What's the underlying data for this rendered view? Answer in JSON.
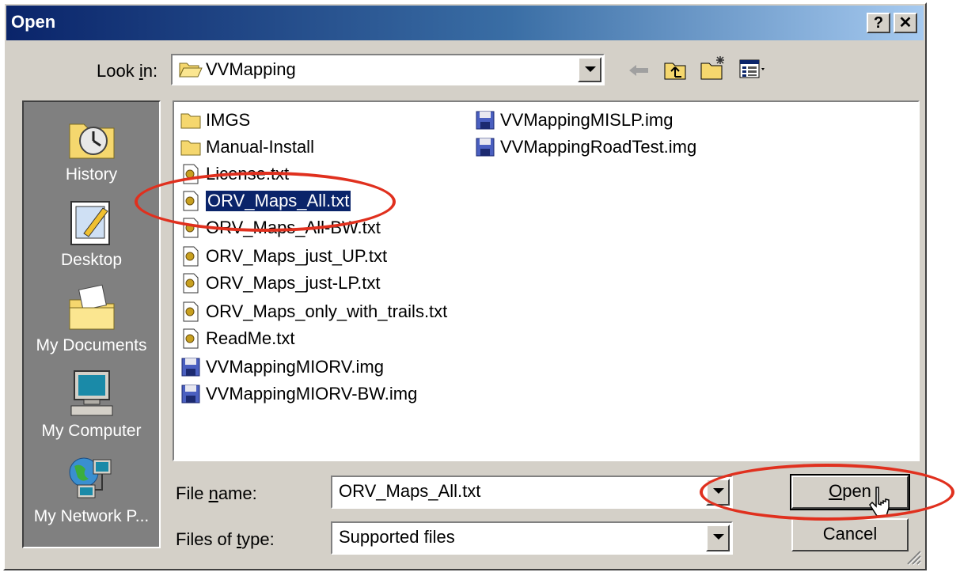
{
  "window": {
    "title": "Open",
    "help_button": "?",
    "close_button": "✕"
  },
  "look_in": {
    "label_pre": "Look ",
    "label_key": "i",
    "label_post": "n:",
    "value": "VVMapping"
  },
  "toolbar": {
    "icons": [
      "back-icon",
      "up-folder-icon",
      "new-folder-icon",
      "view-menu-icon"
    ]
  },
  "places": [
    {
      "label": "History",
      "icon": "history-icon"
    },
    {
      "label": "Desktop",
      "icon": "desktop-icon"
    },
    {
      "label": "My Documents",
      "icon": "my-documents-icon"
    },
    {
      "label": "My Computer",
      "icon": "my-computer-icon"
    },
    {
      "label": "My Network P...",
      "icon": "my-network-icon"
    }
  ],
  "files": [
    {
      "name": "IMGS",
      "type": "folder"
    },
    {
      "name": "Manual-Install",
      "type": "folder"
    },
    {
      "name": "License.txt",
      "type": "txt"
    },
    {
      "name": "ORV_Maps_All.txt",
      "type": "txt",
      "selected": true
    },
    {
      "name": "ORV_Maps_All-BW.txt",
      "type": "txt"
    },
    {
      "name": "ORV_Maps_just_UP.txt",
      "type": "txt"
    },
    {
      "name": "ORV_Maps_just-LP.txt",
      "type": "txt"
    },
    {
      "name": "ORV_Maps_only_with_trails.txt",
      "type": "txt"
    },
    {
      "name": "ReadMe.txt",
      "type": "txt"
    },
    {
      "name": "VVMappingMIORV.img",
      "type": "img"
    },
    {
      "name": "VVMappingMIORV-BW.img",
      "type": "img"
    },
    {
      "name": "VVMappingMISLP.img",
      "type": "img"
    },
    {
      "name": "VVMappingRoadTest.img",
      "type": "img"
    }
  ],
  "file_name": {
    "label_pre": "File ",
    "label_key": "n",
    "label_post": "ame:",
    "value": "ORV_Maps_All.txt"
  },
  "file_type": {
    "label_pre": "Files of ",
    "label_key": "t",
    "label_post": "ype:",
    "value": "Supported files"
  },
  "buttons": {
    "open_key": "O",
    "open_rest": "pen",
    "cancel": "Cancel"
  },
  "colors": {
    "annotation": "#e0301e",
    "selection": "#0a246a"
  }
}
